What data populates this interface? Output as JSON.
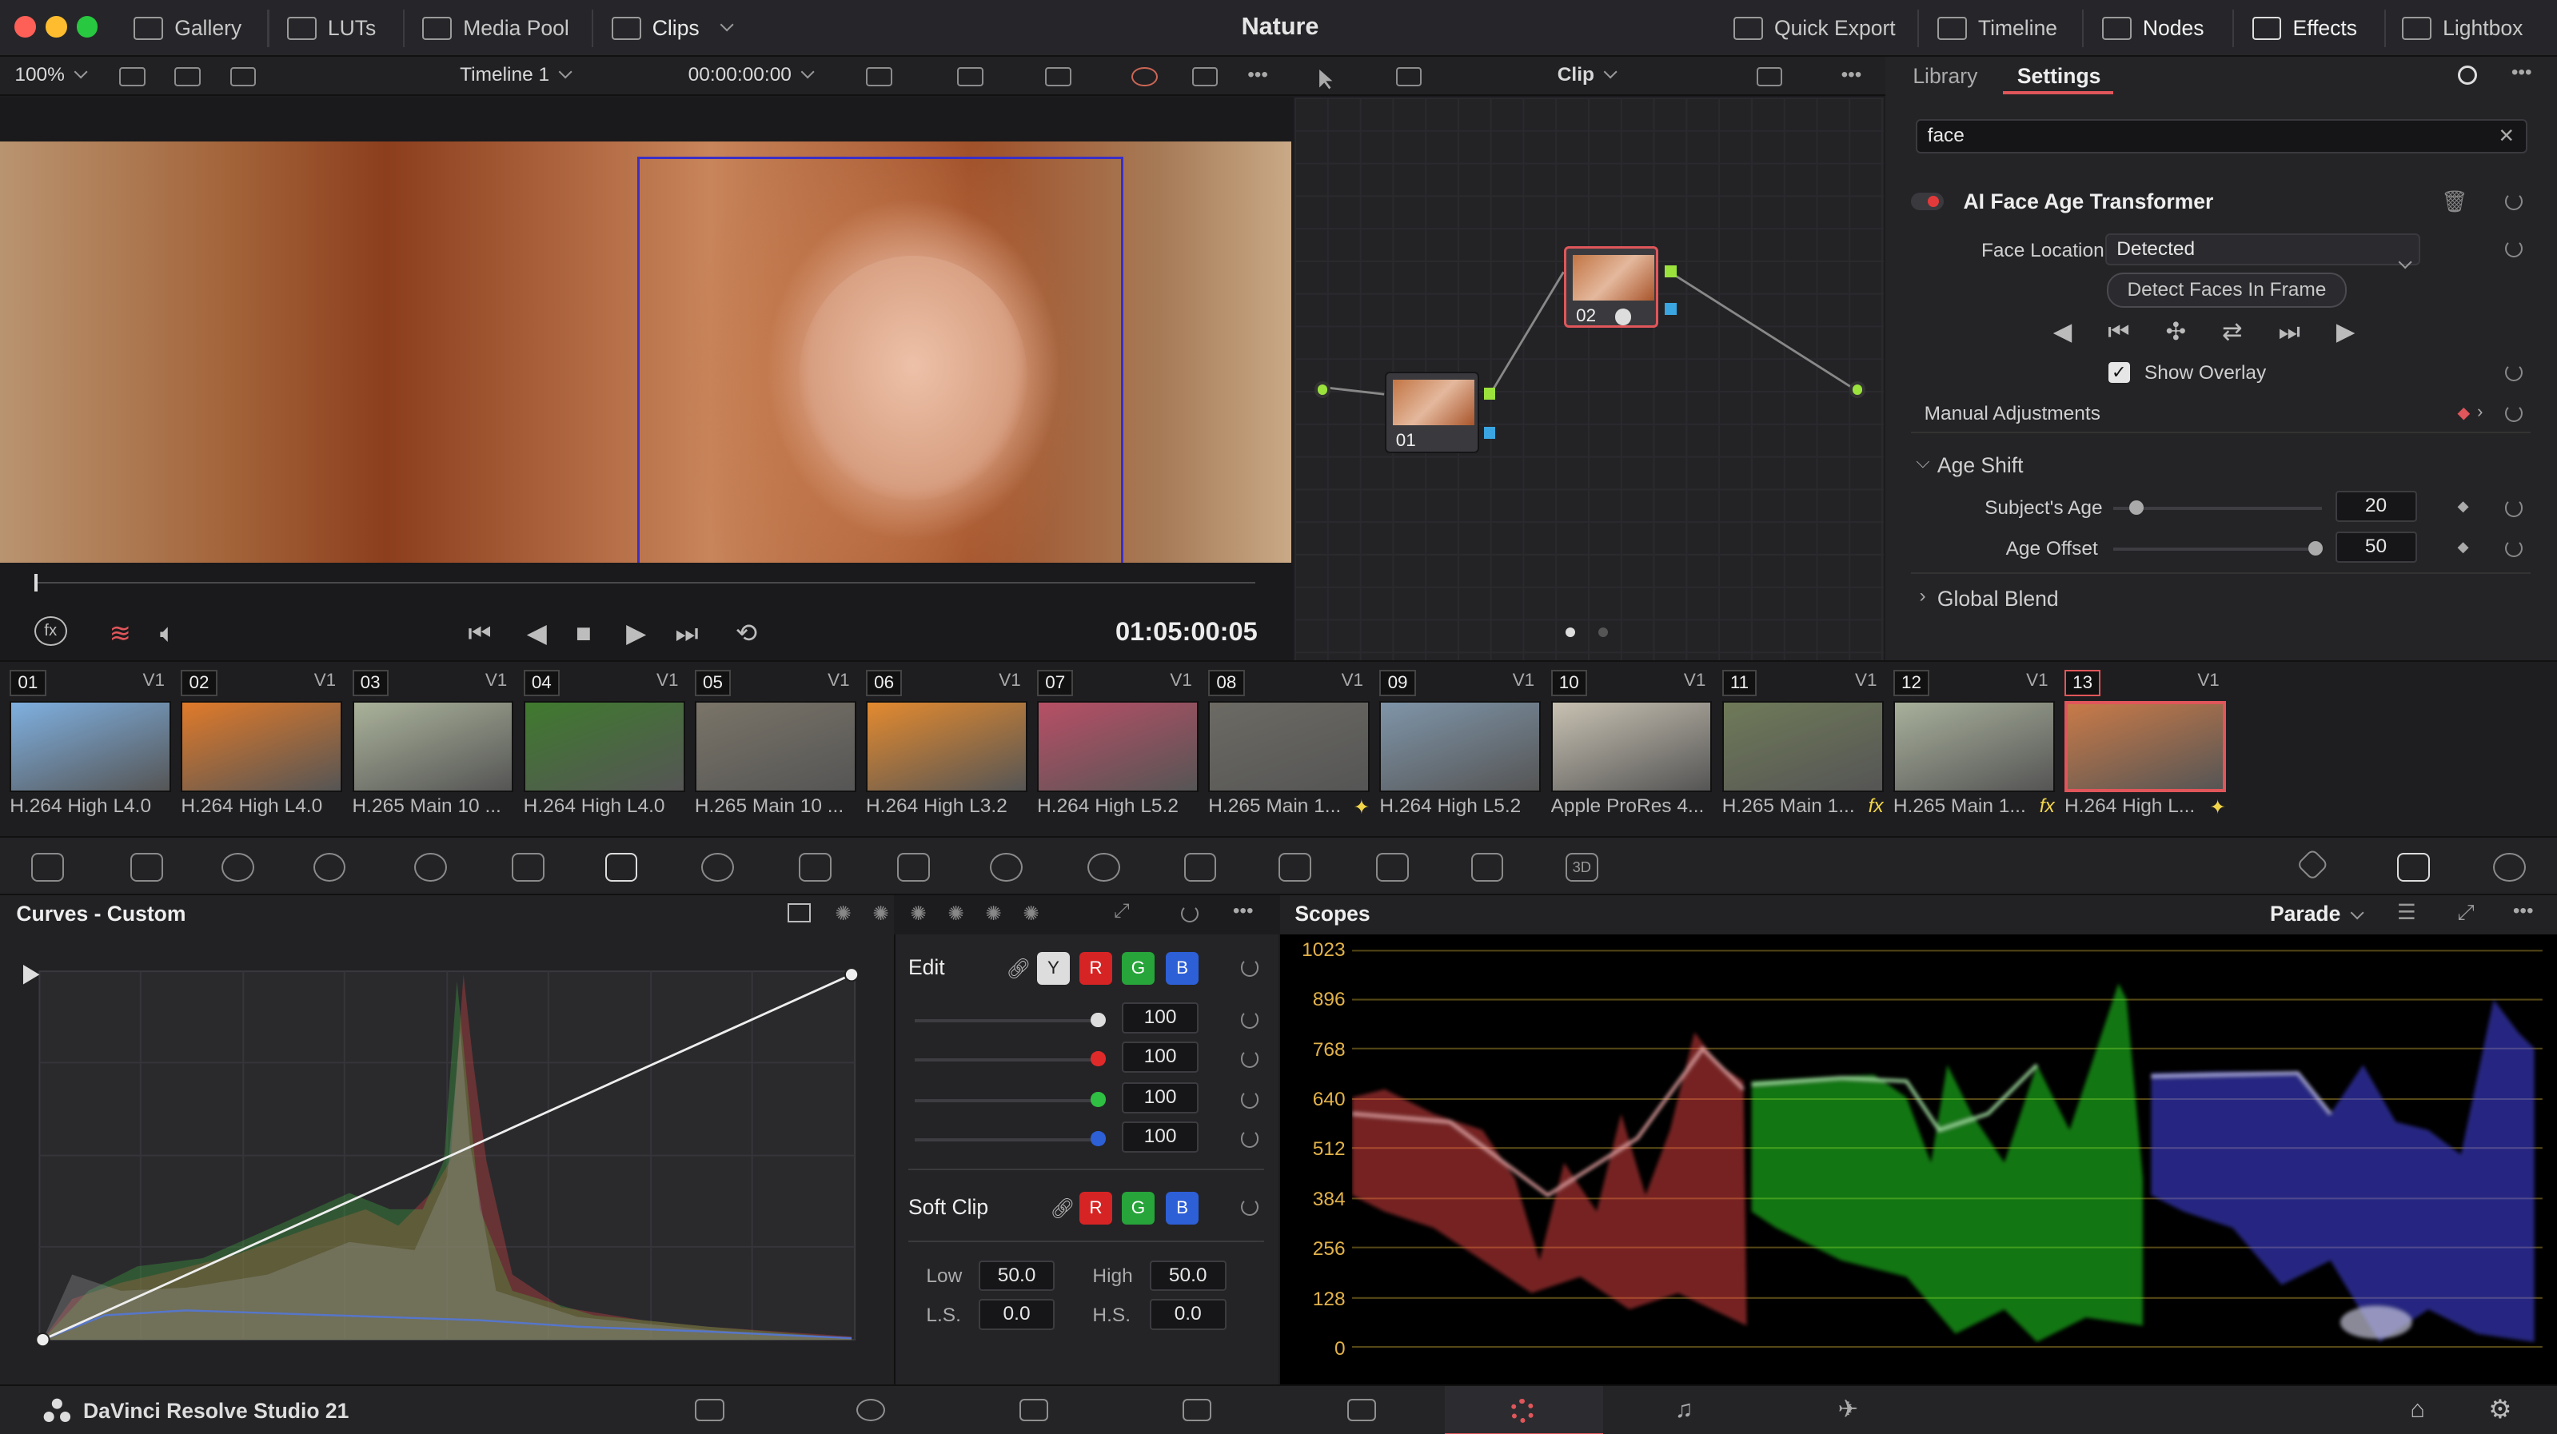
{
  "app": {
    "title": "Nature",
    "product": "DaVinci Resolve Studio 21"
  },
  "topbar": {
    "gallery": "Gallery",
    "luts": "LUTs",
    "media_pool": "Media Pool",
    "clips": "Clips",
    "quick_export": "Quick Export",
    "timeline": "Timeline",
    "nodes": "Nodes",
    "effects": "Effects",
    "lightbox": "Lightbox"
  },
  "viewer": {
    "zoom": "100%",
    "timeline_name": "Timeline 1",
    "timecode_top": "00:00:00:00",
    "timecode": "01:05:00:05"
  },
  "nodes_toolbar": {
    "mode": "Clip"
  },
  "node_editor": {
    "nodes": [
      {
        "label": "01"
      },
      {
        "label": "02"
      }
    ]
  },
  "settings": {
    "tabs": [
      {
        "label": "Library"
      },
      {
        "label": "Settings"
      }
    ],
    "search_value": "face",
    "effect_title": "AI Face Age Transformer",
    "face_location_label": "Face Location",
    "face_location_value": "Detected",
    "detect_button": "Detect Faces In Frame",
    "show_overlay_label": "Show Overlay",
    "show_overlay_checked": true,
    "manual_adjustments": "Manual Adjustments",
    "age_shift": "Age Shift",
    "subjects_age_label": "Subject's Age",
    "subjects_age_value": "20",
    "subjects_age_fraction": 0.08,
    "age_offset_label": "Age Offset",
    "age_offset_value": "50",
    "age_offset_fraction": 0.98,
    "global_blend": "Global Blend"
  },
  "clips": [
    {
      "num": "01",
      "track": "V1",
      "codec": "H.264 High L4.0",
      "color": "#7fb0e0",
      "fx": ""
    },
    {
      "num": "02",
      "track": "V1",
      "codec": "H.264 High L4.0",
      "color": "#e07a2a",
      "fx": ""
    },
    {
      "num": "03",
      "track": "V1",
      "codec": "H.265 Main 10 ...",
      "color": "#aab29a",
      "fx": ""
    },
    {
      "num": "04",
      "track": "V1",
      "codec": "H.264 High L4.0",
      "color": "#3f7a2e",
      "fx": ""
    },
    {
      "num": "05",
      "track": "V1",
      "codec": "H.265 Main 10 ...",
      "color": "#7a7468",
      "fx": ""
    },
    {
      "num": "06",
      "track": "V1",
      "codec": "H.264 High L3.2",
      "color": "#e38a2f",
      "fx": ""
    },
    {
      "num": "07",
      "track": "V1",
      "codec": "H.264 High L5.2",
      "color": "#b84f66",
      "fx": ""
    },
    {
      "num": "08",
      "track": "V1",
      "codec": "H.265 Main 1...",
      "color": "#6c6a63",
      "fx": "✦"
    },
    {
      "num": "09",
      "track": "V1",
      "codec": "H.264 High L5.2",
      "color": "#7f95a9",
      "fx": ""
    },
    {
      "num": "10",
      "track": "V1",
      "codec": "Apple ProRes 4...",
      "color": "#c8c1b2",
      "fx": ""
    },
    {
      "num": "11",
      "track": "V1",
      "codec": "H.265 Main 1...",
      "color": "#6f7a58",
      "fx": "fx"
    },
    {
      "num": "12",
      "track": "V1",
      "codec": "H.265 Main 1...",
      "color": "#a8b09b",
      "fx": "fx"
    },
    {
      "num": "13",
      "track": "V1",
      "codec": "H.264 High L...",
      "color": "#c97a48",
      "fx": "✦"
    }
  ],
  "curves": {
    "title": "Curves - Custom"
  },
  "edit": {
    "label": "Edit",
    "channels": [
      "Y",
      "R",
      "G",
      "B"
    ],
    "values": [
      "100",
      "100",
      "100",
      "100"
    ],
    "soft_clip": "Soft Clip",
    "soft_channels": [
      "R",
      "G",
      "B"
    ],
    "low_label": "Low",
    "low_value": "50.0",
    "high_label": "High",
    "high_value": "50.0",
    "ls_label": "L.S.",
    "ls_value": "0.0",
    "hs_label": "H.S.",
    "hs_value": "0.0"
  },
  "scopes": {
    "title": "Scopes",
    "mode": "Parade",
    "scale": [
      "1023",
      "896",
      "768",
      "640",
      "512",
      "384",
      "256",
      "128",
      "0"
    ]
  },
  "colors": {
    "accent": "#e0565a",
    "waveform_red": "#ff5a5a",
    "waveform_green": "#3dff3d",
    "waveform_blue": "#5a5aff"
  }
}
